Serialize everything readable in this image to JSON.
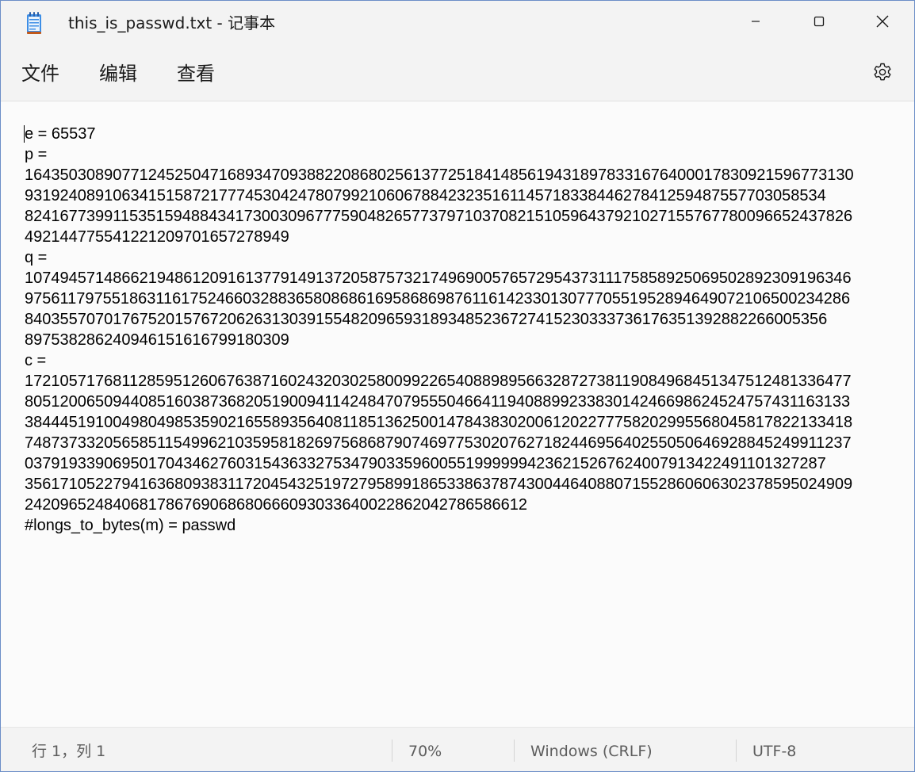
{
  "window": {
    "title": "this_is_passwd.txt - 记事本"
  },
  "icons": {
    "app": "notepad-icon",
    "minimize": "minimize-icon",
    "maximize": "maximize-icon",
    "close": "close-icon",
    "settings": "gear-icon"
  },
  "menu": {
    "file": "文件",
    "edit": "编辑",
    "view": "查看"
  },
  "editor": {
    "lines": [
      "e = 65537",
      "p =",
      "1643503089077124525047168934709388220868025613772518414856194318978331676400017830921596773130",
      "9319240891063415158721777453042478079921060678842323516114571833844627841259487557703058534",
      "8241677399115351594884341730030967775904826577379710370821510596437921027155767780096652437826",
      "492144775541221209701657278949",
      "q =",
      "1074945714866219486120916137791491372058757321749690057657295437311175858925069502892309196346",
      "9756117975518631161752466032883658086861695868698761161423301307770551952894649072106500234286",
      "8403557070176752015767206263130391554820965931893485236727415230333736176351392882266005356",
      "89753828624094615161679918030​9",
      "c =",
      "1721057176811285951260676387160243203025800992265408898956632872738119084968451347512481336477",
      "8051200650944085160387368205190094114248470795550466411940889923383014246698624524757431163133",
      "3844451910049804985359021655893564081185136250014784383020061202277758202995568045817822133418",
      "7487373320565851154996210359581826975686879074697753020762718244695640255050646928845249911237",
      "0379193390695017043462760315436332753479033596005519999994236215267624007913422491101327287",
      "3561710522794163680938311720454325197279589918653386378743004464088071552860606302378595024909",
      "24209652484068178676906868066609303364002286204278658661​2",
      "#longs_to_bytes(m) = passwd"
    ]
  },
  "status": {
    "position": "行 1，列 1",
    "zoom": "70%",
    "line_ending": "Windows (CRLF)",
    "encoding": "UTF-8"
  }
}
